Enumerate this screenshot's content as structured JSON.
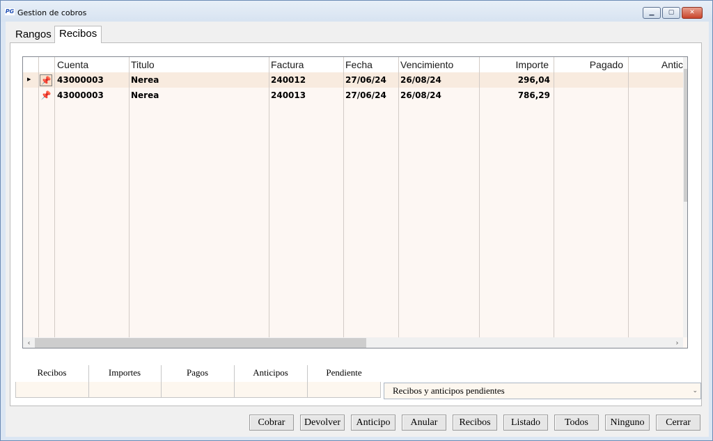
{
  "window": {
    "title": "Gestion de cobros",
    "app_icon_text": "PG"
  },
  "tabs": [
    {
      "label": "Rangos"
    },
    {
      "label": "Recibos"
    }
  ],
  "grid": {
    "columns": [
      {
        "label": "Cuenta"
      },
      {
        "label": "Titulo"
      },
      {
        "label": "Factura"
      },
      {
        "label": "Fecha"
      },
      {
        "label": "Vencimiento"
      },
      {
        "label": "Importe"
      },
      {
        "label": "Pagado"
      },
      {
        "label": "Antic"
      }
    ],
    "rows": [
      {
        "cuenta": "43000003",
        "titulo": "Nerea",
        "factura": "240012",
        "fecha": "27/06/24",
        "vencimiento": "26/08/24",
        "importe": "296,04",
        "pagado": "",
        "anticipo": ""
      },
      {
        "cuenta": "43000003",
        "titulo": "Nerea",
        "factura": "240013",
        "fecha": "27/06/24",
        "vencimiento": "26/08/24",
        "importe": "786,29",
        "pagado": "",
        "anticipo": ""
      }
    ]
  },
  "summary": {
    "headers": [
      "Recibos",
      "Importes",
      "Pagos",
      "Anticipos",
      "Pendiente"
    ],
    "values": [
      "",
      "",
      "",
      "",
      ""
    ]
  },
  "filter": {
    "selected": "Recibos y anticipos pendientes"
  },
  "buttons": [
    "Cobrar",
    "Devolver",
    "Anticipo",
    "Anular",
    "Recibos",
    "Listado",
    "Todos",
    "Ninguno",
    "Cerrar"
  ],
  "colors": {
    "selected_row": "#f8ebdf",
    "grid_background": "#fdf7f3",
    "title_bar": "#dbe6f3"
  }
}
